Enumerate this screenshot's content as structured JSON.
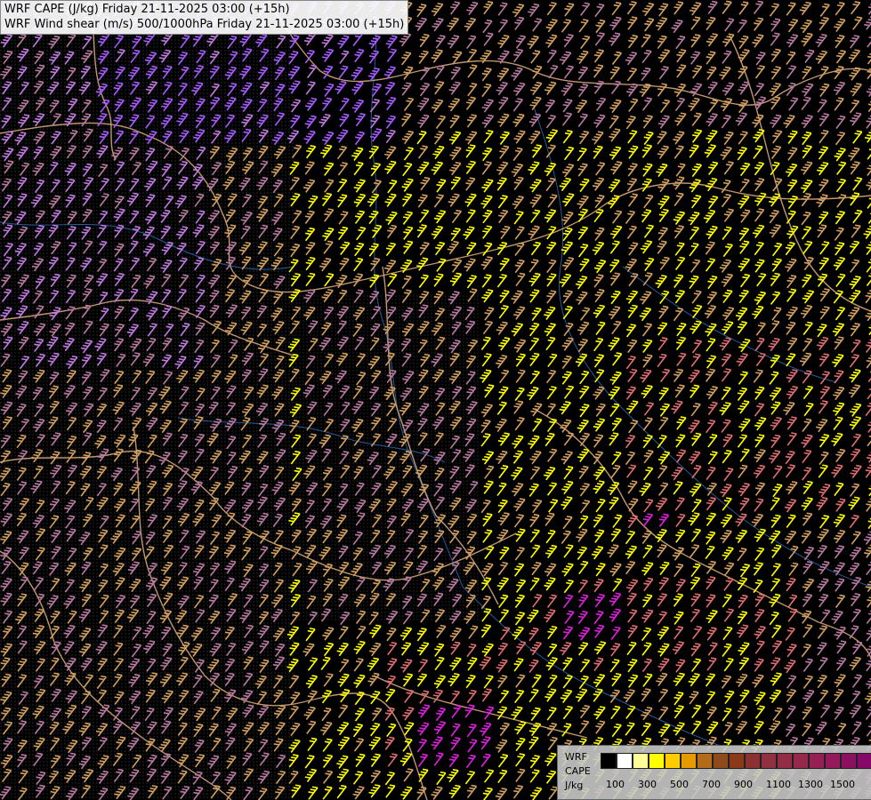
{
  "titles": {
    "line1": "WRF CAPE (J/kg) Friday 21-11-2025 03:00 (+15h)",
    "line2": "WRF Wind shear (m/s) 500/1000hPa Friday 21-11-2025 03:00 (+15h)"
  },
  "legend": {
    "label1": "WRF",
    "label2": "CAPE",
    "label3": "J/kg",
    "colors": [
      "#000000",
      "#ffffff",
      "#ffff99",
      "#ffff00",
      "#ffcc00",
      "#e69a00",
      "#b36b1a",
      "#8f4a1c",
      "#8a3a1a",
      "#8c3030",
      "#903040",
      "#932c44",
      "#96284c",
      "#962054",
      "#941a5c",
      "#8c1060",
      "#860868",
      "#7a0070"
    ],
    "ticks": [
      "100",
      "300",
      "500",
      "700",
      "900",
      "1100",
      "1300",
      "1500"
    ]
  },
  "map": {
    "background": "#000000",
    "barb_colors": {
      "purple": "#a65cff",
      "violet": "#c07ae0",
      "mauve": "#b87aa0",
      "tan": "#d4a060",
      "yellow": "#ffff00",
      "salmon": "#e07070",
      "magenta": "#e020e0"
    },
    "border_color": "#e0b080",
    "river_color": "#3070c0"
  }
}
